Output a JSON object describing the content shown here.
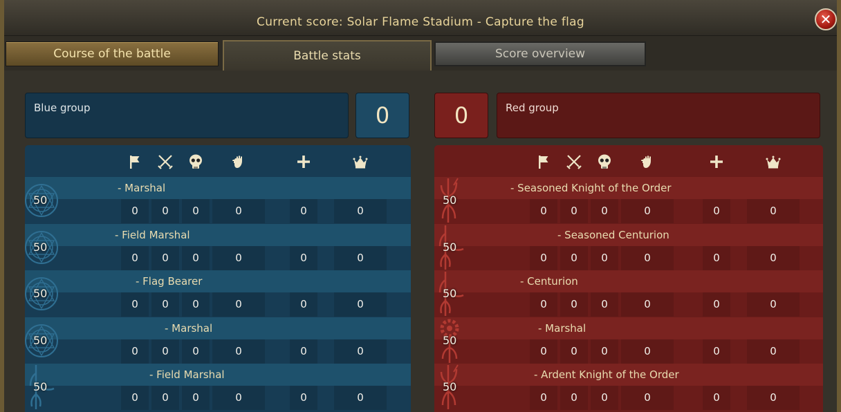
{
  "window": {
    "title": "Current score: Solar Flame Stadium - Capture the flag",
    "close_icon": "close-icon"
  },
  "tabs": [
    {
      "label": "Course of the battle",
      "state": "normal"
    },
    {
      "label": "Battle stats",
      "state": "active"
    },
    {
      "label": "Score overview",
      "state": "disabled"
    }
  ],
  "stat_icons": [
    "flag-icon",
    "crossed-swords-icon",
    "skull-icon",
    "fist-icon",
    "plus-icon",
    "crown-icon"
  ],
  "blue": {
    "group_label": "Blue group",
    "score": "0",
    "color": "#15354a",
    "players": [
      {
        "level": "50",
        "emblem": "circle-rune-emblem",
        "name": "- Marshal",
        "stats": [
          "0",
          "0",
          "0",
          "0",
          "0",
          "0"
        ]
      },
      {
        "level": "50",
        "emblem": "circle-rune-emblem",
        "name": "- Field Marshal",
        "stats": [
          "0",
          "0",
          "0",
          "0",
          "0",
          "0"
        ]
      },
      {
        "level": "50",
        "emblem": "circle-rune-emblem",
        "name": "- Flag Bearer",
        "stats": [
          "0",
          "0",
          "0",
          "0",
          "0",
          "0"
        ]
      },
      {
        "level": "50",
        "emblem": "circle-rune-emblem",
        "name": "- Marshal",
        "stats": [
          "0",
          "0",
          "0",
          "0",
          "0",
          "0"
        ]
      },
      {
        "level": "50",
        "emblem": "branch-emblem",
        "name": "- Field Marshal",
        "stats": [
          "0",
          "0",
          "0",
          "0",
          "0",
          "0"
        ]
      }
    ]
  },
  "red": {
    "group_label": "Red group",
    "score": "0",
    "color": "#5b1816",
    "players": [
      {
        "level": "50",
        "emblem": "trident-emblem",
        "name": "- Seasoned Knight of the Order",
        "stats": [
          "0",
          "0",
          "0",
          "0",
          "0",
          "0"
        ]
      },
      {
        "level": "50",
        "emblem": "branch-emblem",
        "name": "- Seasoned Centurion",
        "stats": [
          "0",
          "0",
          "0",
          "0",
          "0",
          "0"
        ]
      },
      {
        "level": "50",
        "emblem": "branch-emblem",
        "name": "- Centurion",
        "stats": [
          "0",
          "0",
          "0",
          "0",
          "0",
          "0"
        ]
      },
      {
        "level": "50",
        "emblem": "gear-emblem",
        "name": "- Marshal",
        "stats": [
          "0",
          "0",
          "0",
          "0",
          "0",
          "0"
        ]
      },
      {
        "level": "50",
        "emblem": "trident-emblem",
        "name": "- Ardent Knight of the Order",
        "stats": [
          "0",
          "0",
          "0",
          "0",
          "0",
          "0"
        ]
      }
    ]
  }
}
